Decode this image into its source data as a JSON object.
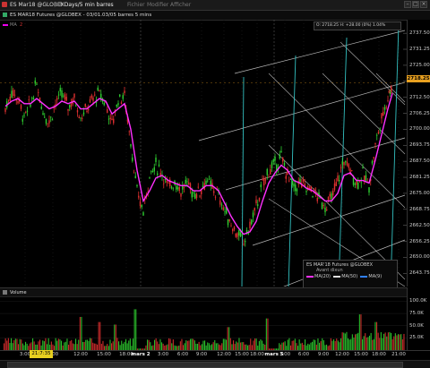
{
  "window": {
    "title": "ES Mar18 @GLOBEX",
    "timeframe": "3 Days/5 min barres",
    "menu": [
      "Fichier",
      "Modifier",
      "Afficher"
    ]
  },
  "infobar": {
    "text": "ES MAR18 Futures @GLOBEX - 03/01.03/05 barres 5 mins"
  },
  "legend": {
    "label": "MA",
    "value": "2"
  },
  "crosshair_info": "O: 2718.25  H: +28.00 (0%)  1.04%",
  "last_price": "2718.25",
  "cursor_time": "21:7:35",
  "study_box": {
    "header": "ES MAR'18 Futures @GLOBEX",
    "subheader": "Avant dixun",
    "entries": [
      {
        "label": "MA(20)",
        "color": "#ff30ff"
      },
      {
        "label": "MA(50)",
        "color": "#e0e0e0"
      },
      {
        "label": "MA(9)",
        "color": "#3080ff"
      }
    ]
  },
  "volume_header": "Volume",
  "colors": {
    "up": "#2fd030",
    "down": "#e03030",
    "ma": "#ff30ff",
    "trendline": "#d8d8d8",
    "cyan": "#33c0c0",
    "accent": "#e8a020"
  },
  "chart_data": [
    {
      "type": "line",
      "title": "",
      "ylabel": "",
      "ylim": [
        2640,
        2740
      ],
      "yticks": [
        2737.5,
        2731.25,
        2725.0,
        2718.75,
        2712.5,
        2706.25,
        2700.0,
        2693.75,
        2687.5,
        2681.25,
        2675.0,
        2668.75,
        2662.5,
        2656.25,
        2650.0,
        2643.75
      ],
      "ytick_labels": [
        "2737.50",
        "2731.25",
        "2725.00",
        "2718.75",
        "2712.50",
        "2706.25",
        "2700.00",
        "2693.75",
        "2687.50",
        "2681.25",
        "2675.00",
        "2668.75",
        "2662.50",
        "2656.25",
        "2650.00",
        "2643.75"
      ],
      "x": [
        0,
        7,
        14,
        21,
        28,
        35,
        42,
        49,
        56,
        63,
        70,
        77,
        84,
        91,
        98,
        105,
        112,
        119,
        126,
        133,
        140,
        147,
        154,
        161,
        168,
        175,
        182,
        189,
        196,
        203,
        210,
        217,
        224,
        231,
        238,
        245,
        252,
        259,
        266,
        273,
        280,
        287,
        294,
        301,
        308,
        315,
        322,
        329,
        336,
        343,
        350,
        357,
        364,
        371,
        378,
        385,
        392,
        399,
        406,
        413,
        420,
        427,
        432
      ],
      "series": [
        {
          "name": "Price",
          "values": [
            2708,
            2715,
            2712,
            2704,
            2710,
            2718,
            2707,
            2703,
            2710,
            2714,
            2709,
            2712,
            2705,
            2708,
            2712,
            2714,
            2710,
            2702,
            2712,
            2713,
            2695,
            2675,
            2668,
            2682,
            2686,
            2683,
            2677,
            2680,
            2676,
            2679,
            2675,
            2676,
            2680,
            2677,
            2674,
            2668,
            2663,
            2659,
            2656,
            2662,
            2670,
            2678,
            2684,
            2686,
            2689,
            2682,
            2677,
            2679,
            2677,
            2676,
            2673,
            2670,
            2673,
            2680,
            2688,
            2684,
            2679,
            2682,
            2678,
            2694,
            2704,
            2713,
            2718
          ]
        },
        {
          "name": "MA(20)",
          "values": [
            2709,
            2711,
            2712,
            2710,
            2710,
            2712,
            2710,
            2708,
            2709,
            2711,
            2710,
            2711,
            2708,
            2708,
            2710,
            2712,
            2711,
            2706,
            2708,
            2710,
            2700,
            2684,
            2672,
            2676,
            2681,
            2682,
            2680,
            2679,
            2678,
            2678,
            2676,
            2676,
            2678,
            2678,
            2676,
            2671,
            2666,
            2662,
            2659,
            2660,
            2664,
            2672,
            2679,
            2683,
            2686,
            2684,
            2680,
            2679,
            2677,
            2676,
            2674,
            2672,
            2672,
            2675,
            2682,
            2683,
            2680,
            2680,
            2679,
            2688,
            2698,
            2708,
            2714
          ]
        }
      ]
    },
    {
      "type": "bar",
      "title": "Volume",
      "ylim": [
        0,
        110000
      ],
      "ytick_labels": [
        "100.0K",
        "75.0K",
        "50.0K",
        "25.0K"
      ],
      "yticks": [
        100000,
        75000,
        50000,
        25000
      ]
    }
  ],
  "time_axis": {
    "ticks": [
      {
        "label": "3:00",
        "x": 28
      },
      {
        "label": "9:00",
        "x": 59
      },
      {
        "label": "12:00",
        "x": 90
      },
      {
        "label": "15:00",
        "x": 116
      },
      {
        "label": "18:00",
        "x": 141
      },
      {
        "label": "mars 2",
        "x": 157,
        "day": true
      },
      {
        "label": "3:00",
        "x": 182
      },
      {
        "label": "6:00",
        "x": 204
      },
      {
        "label": "9:00",
        "x": 225
      },
      {
        "label": "12:00",
        "x": 250
      },
      {
        "label": "15:00",
        "x": 270
      },
      {
        "label": "18:00",
        "x": 287
      },
      {
        "label": "mars 5",
        "x": 306,
        "day": true
      },
      {
        "label": "3:00",
        "x": 318
      },
      {
        "label": "6:00",
        "x": 339
      },
      {
        "label": "9:00",
        "x": 361
      },
      {
        "label": "12:00",
        "x": 382
      },
      {
        "label": "15:00",
        "x": 403
      },
      {
        "label": "18:00",
        "x": 423
      },
      {
        "label": "21:00",
        "x": 445
      }
    ]
  }
}
